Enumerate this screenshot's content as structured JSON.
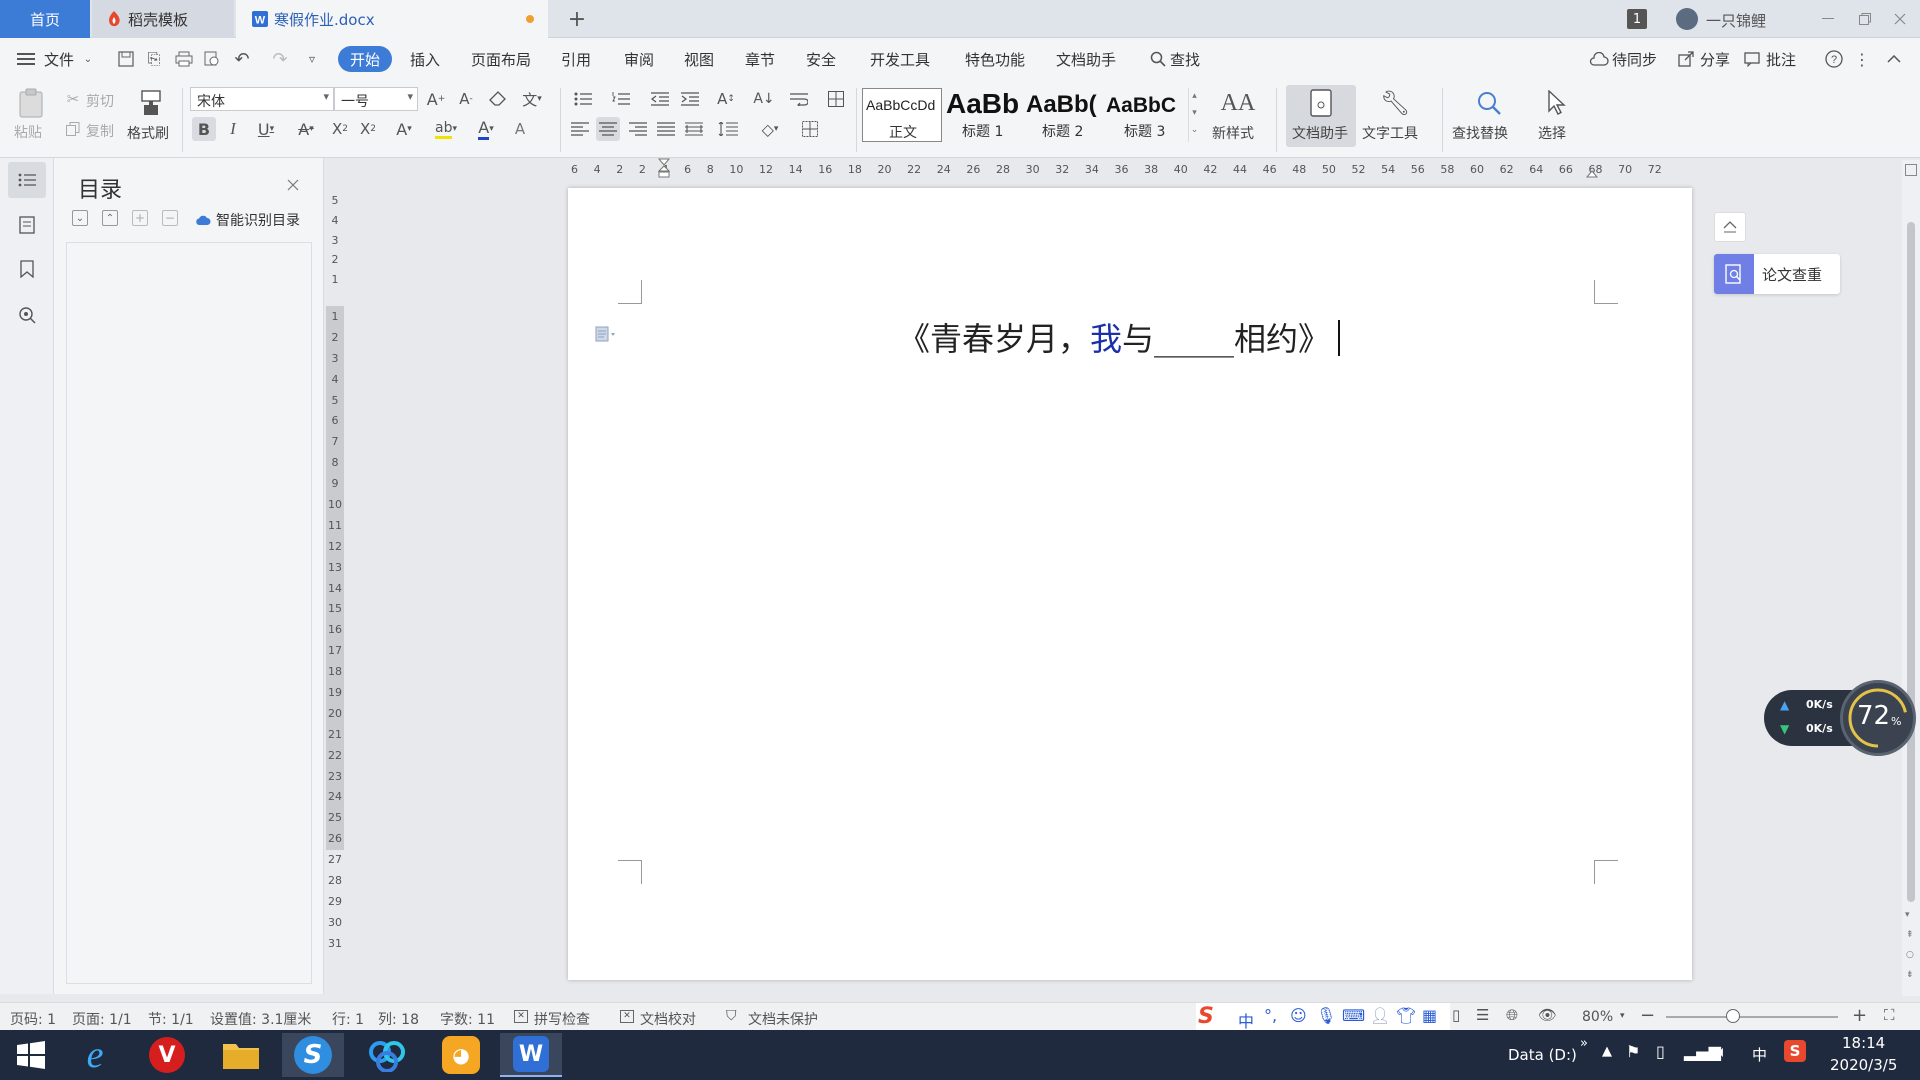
{
  "titlebar": {
    "tabs": [
      {
        "label": "首页"
      },
      {
        "label": "稻壳模板"
      },
      {
        "label": "寒假作业.docx"
      }
    ],
    "page_counter": "1",
    "user_name": "一只锦鲤"
  },
  "menu": {
    "file": "文件",
    "items": [
      "开始",
      "插入",
      "页面布局",
      "引用",
      "审阅",
      "视图",
      "章节",
      "安全",
      "开发工具",
      "特色功能",
      "文档助手"
    ],
    "search": "查找",
    "sync": "待同步",
    "share": "分享",
    "annotate": "批注"
  },
  "toolbar": {
    "paste": "粘贴",
    "cut": "剪切",
    "copy": "复制",
    "format_painter": "格式刷",
    "font_name": "宋体",
    "font_size": "一号",
    "styles": [
      {
        "preview": "AaBbCcDd",
        "label": "正文"
      },
      {
        "preview": "AaBb",
        "label": "标题 1"
      },
      {
        "preview": "AaBb(",
        "label": "标题 2"
      },
      {
        "preview": "AaBbC",
        "label": "标题 3"
      }
    ],
    "new_style": "新样式",
    "doc_assistant": "文档助手",
    "text_tools": "文字工具",
    "find_replace": "查找替换",
    "select": "选择"
  },
  "nav": {
    "title": "目录",
    "smart_toc": "智能识别目录"
  },
  "rulers": {
    "top": [
      "6",
      "4",
      "2",
      "2",
      "4",
      "6",
      "8",
      "10",
      "12",
      "14",
      "16",
      "18",
      "20",
      "22",
      "24",
      "26",
      "28",
      "30",
      "32",
      "34",
      "36",
      "38",
      "40",
      "42",
      "44",
      "46",
      "48",
      "50",
      "52",
      "54",
      "56",
      "58",
      "60",
      "62",
      "64",
      "66",
      "68",
      "70",
      "72"
    ],
    "left_top": [
      "5",
      "4",
      "3",
      "2",
      "1"
    ],
    "left": [
      "1",
      "2",
      "3",
      "4",
      "5",
      "6",
      "7",
      "8",
      "9",
      "10",
      "11",
      "12",
      "13",
      "14",
      "15",
      "16",
      "17",
      "18",
      "19",
      "20",
      "21",
      "22",
      "23",
      "24",
      "25",
      "26",
      "27",
      "28",
      "29",
      "30",
      "31"
    ]
  },
  "document": {
    "title_before": "《青春岁月，",
    "title_highlight": "我",
    "title_mid": "与",
    "title_blank": "_____",
    "title_after": "相约》"
  },
  "side_panel": {
    "plagiarism": "论文查重"
  },
  "net_widget": {
    "up": "0K/s",
    "down": "0K/s",
    "percent": "72",
    "percent_unit": "%"
  },
  "status": {
    "page_num": "页码: 1",
    "pages": "页面: 1/1",
    "section": "节: 1/1",
    "setting": "设置值: 3.1厘米",
    "row": "行: 1",
    "col": "列: 18",
    "word_count": "字数: 11",
    "spell_check": "拼写检查",
    "proofread": "文档校对",
    "protection": "文档未保护",
    "zoom": "80%",
    "ime": "中"
  },
  "taskbar": {
    "drive": "Data (D:)",
    "ime": "中",
    "time": "18:14",
    "date": "2020/3/5"
  },
  "colors": {
    "accent": "#3c7bd6",
    "highlight_text": "#1a2fa8",
    "taskbar": "#1f2a3e"
  }
}
